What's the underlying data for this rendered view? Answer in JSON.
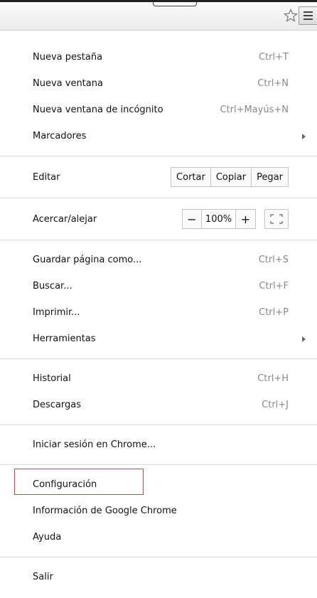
{
  "toolbar": {
    "star_icon": "star-outline-icon",
    "menu_icon": "hamburger-menu-icon"
  },
  "menu": {
    "section1": [
      {
        "label": "Nueva pestaña",
        "shortcut": "Ctrl+T"
      },
      {
        "label": "Nueva ventana",
        "shortcut": "Ctrl+N"
      },
      {
        "label": "Nueva ventana de incógnito",
        "shortcut": "Ctrl+Mayús+N"
      },
      {
        "label": "Marcadores",
        "shortcut": ""
      }
    ],
    "edit": {
      "label": "Editar",
      "cut": "Cortar",
      "copy": "Copiar",
      "paste": "Pegar"
    },
    "zoom": {
      "label": "Acercar/alejar",
      "minus": "−",
      "value": "100%",
      "plus": "+"
    },
    "section3": [
      {
        "label": "Guardar página como...",
        "shortcut": "Ctrl+S"
      },
      {
        "label": "Buscar...",
        "shortcut": "Ctrl+F"
      },
      {
        "label": "Imprimir...",
        "shortcut": "Ctrl+P"
      },
      {
        "label": "Herramientas",
        "shortcut": ""
      }
    ],
    "section4": [
      {
        "label": "Historial",
        "shortcut": "Ctrl+H"
      },
      {
        "label": "Descargas",
        "shortcut": "Ctrl+J"
      }
    ],
    "signin": {
      "label": "Iniciar sesión en Chrome..."
    },
    "section6": [
      {
        "label": "Configuración"
      },
      {
        "label": "Información de Google Chrome"
      },
      {
        "label": "Ayuda"
      }
    ],
    "exit": {
      "label": "Salir"
    }
  },
  "colors": {
    "highlight_border": "#e53935"
  }
}
